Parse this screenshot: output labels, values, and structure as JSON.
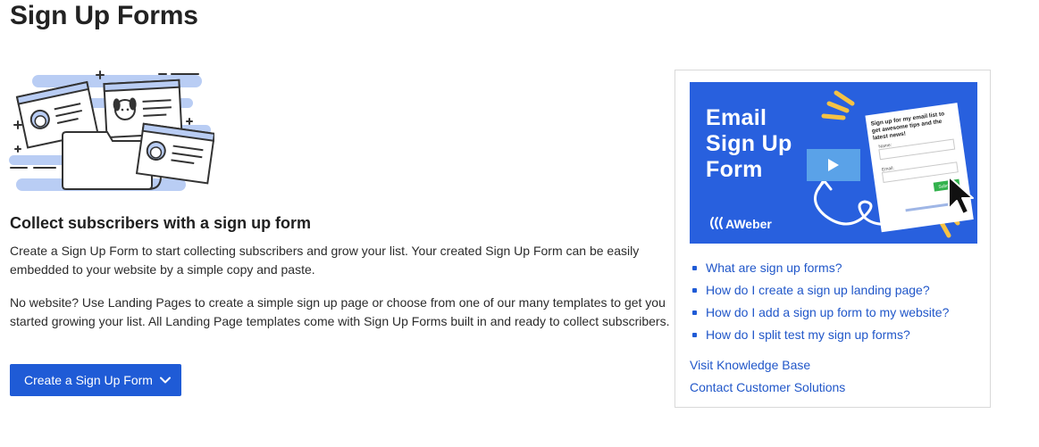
{
  "page": {
    "title": "Sign Up Forms"
  },
  "intro": {
    "heading": "Collect subscribers with a sign up form",
    "paragraph_1": "Create a Sign Up Form to start collecting subscribers and grow your list. Your created Sign Up Form can be easily embedded to your website by a simple copy and paste.",
    "paragraph_2": "No website? Use Landing Pages to create a simple sign up page or choose from one of our many templates to get you started growing your list. All Landing Page templates come with Sign Up Forms built in and ready to collect subscribers.",
    "create_button_label": "Create a Sign Up Form",
    "create_button_icon": "chevron-down-icon"
  },
  "help_card": {
    "video": {
      "title_line_1": "Email",
      "title_line_2": "Sign Up",
      "title_line_3": "Form",
      "brand": "AWeber",
      "form_mock_heading": "Sign up for my email list to get awesome tips and the latest news!",
      "form_mock_name_label": "Name:",
      "form_mock_email_label": "Email:",
      "form_mock_submit": "Submit",
      "play_icon": "play-icon"
    },
    "links": [
      {
        "label": "What are sign up forms?"
      },
      {
        "label": "How do I create a sign up landing page?"
      },
      {
        "label": "How do I add a sign up form to my website?"
      },
      {
        "label": "How do I split test my sign up forms?"
      }
    ],
    "knowledge_base_label": "Visit Knowledge Base",
    "contact_label": "Contact Customer Solutions"
  },
  "colors": {
    "primary": "#1f5bd6",
    "video_background": "#2860de",
    "illustration_accent": "#b9cdf4"
  }
}
